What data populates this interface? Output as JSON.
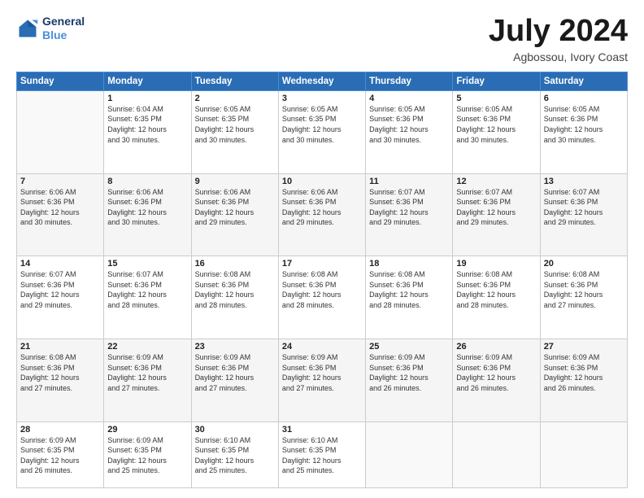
{
  "header": {
    "logo_line1": "General",
    "logo_line2": "Blue",
    "month_year": "July 2024",
    "location": "Agbossou, Ivory Coast"
  },
  "weekdays": [
    "Sunday",
    "Monday",
    "Tuesday",
    "Wednesday",
    "Thursday",
    "Friday",
    "Saturday"
  ],
  "weeks": [
    [
      {
        "day": "",
        "detail": ""
      },
      {
        "day": "1",
        "detail": "Sunrise: 6:04 AM\nSunset: 6:35 PM\nDaylight: 12 hours\nand 30 minutes."
      },
      {
        "day": "2",
        "detail": "Sunrise: 6:05 AM\nSunset: 6:35 PM\nDaylight: 12 hours\nand 30 minutes."
      },
      {
        "day": "3",
        "detail": "Sunrise: 6:05 AM\nSunset: 6:35 PM\nDaylight: 12 hours\nand 30 minutes."
      },
      {
        "day": "4",
        "detail": "Sunrise: 6:05 AM\nSunset: 6:36 PM\nDaylight: 12 hours\nand 30 minutes."
      },
      {
        "day": "5",
        "detail": "Sunrise: 6:05 AM\nSunset: 6:36 PM\nDaylight: 12 hours\nand 30 minutes."
      },
      {
        "day": "6",
        "detail": "Sunrise: 6:05 AM\nSunset: 6:36 PM\nDaylight: 12 hours\nand 30 minutes."
      }
    ],
    [
      {
        "day": "7",
        "detail": "Sunrise: 6:06 AM\nSunset: 6:36 PM\nDaylight: 12 hours\nand 30 minutes."
      },
      {
        "day": "8",
        "detail": "Sunrise: 6:06 AM\nSunset: 6:36 PM\nDaylight: 12 hours\nand 30 minutes."
      },
      {
        "day": "9",
        "detail": "Sunrise: 6:06 AM\nSunset: 6:36 PM\nDaylight: 12 hours\nand 29 minutes."
      },
      {
        "day": "10",
        "detail": "Sunrise: 6:06 AM\nSunset: 6:36 PM\nDaylight: 12 hours\nand 29 minutes."
      },
      {
        "day": "11",
        "detail": "Sunrise: 6:07 AM\nSunset: 6:36 PM\nDaylight: 12 hours\nand 29 minutes."
      },
      {
        "day": "12",
        "detail": "Sunrise: 6:07 AM\nSunset: 6:36 PM\nDaylight: 12 hours\nand 29 minutes."
      },
      {
        "day": "13",
        "detail": "Sunrise: 6:07 AM\nSunset: 6:36 PM\nDaylight: 12 hours\nand 29 minutes."
      }
    ],
    [
      {
        "day": "14",
        "detail": "Sunrise: 6:07 AM\nSunset: 6:36 PM\nDaylight: 12 hours\nand 29 minutes."
      },
      {
        "day": "15",
        "detail": "Sunrise: 6:07 AM\nSunset: 6:36 PM\nDaylight: 12 hours\nand 28 minutes."
      },
      {
        "day": "16",
        "detail": "Sunrise: 6:08 AM\nSunset: 6:36 PM\nDaylight: 12 hours\nand 28 minutes."
      },
      {
        "day": "17",
        "detail": "Sunrise: 6:08 AM\nSunset: 6:36 PM\nDaylight: 12 hours\nand 28 minutes."
      },
      {
        "day": "18",
        "detail": "Sunrise: 6:08 AM\nSunset: 6:36 PM\nDaylight: 12 hours\nand 28 minutes."
      },
      {
        "day": "19",
        "detail": "Sunrise: 6:08 AM\nSunset: 6:36 PM\nDaylight: 12 hours\nand 28 minutes."
      },
      {
        "day": "20",
        "detail": "Sunrise: 6:08 AM\nSunset: 6:36 PM\nDaylight: 12 hours\nand 27 minutes."
      }
    ],
    [
      {
        "day": "21",
        "detail": "Sunrise: 6:08 AM\nSunset: 6:36 PM\nDaylight: 12 hours\nand 27 minutes."
      },
      {
        "day": "22",
        "detail": "Sunrise: 6:09 AM\nSunset: 6:36 PM\nDaylight: 12 hours\nand 27 minutes."
      },
      {
        "day": "23",
        "detail": "Sunrise: 6:09 AM\nSunset: 6:36 PM\nDaylight: 12 hours\nand 27 minutes."
      },
      {
        "day": "24",
        "detail": "Sunrise: 6:09 AM\nSunset: 6:36 PM\nDaylight: 12 hours\nand 27 minutes."
      },
      {
        "day": "25",
        "detail": "Sunrise: 6:09 AM\nSunset: 6:36 PM\nDaylight: 12 hours\nand 26 minutes."
      },
      {
        "day": "26",
        "detail": "Sunrise: 6:09 AM\nSunset: 6:36 PM\nDaylight: 12 hours\nand 26 minutes."
      },
      {
        "day": "27",
        "detail": "Sunrise: 6:09 AM\nSunset: 6:36 PM\nDaylight: 12 hours\nand 26 minutes."
      }
    ],
    [
      {
        "day": "28",
        "detail": "Sunrise: 6:09 AM\nSunset: 6:35 PM\nDaylight: 12 hours\nand 26 minutes."
      },
      {
        "day": "29",
        "detail": "Sunrise: 6:09 AM\nSunset: 6:35 PM\nDaylight: 12 hours\nand 25 minutes."
      },
      {
        "day": "30",
        "detail": "Sunrise: 6:10 AM\nSunset: 6:35 PM\nDaylight: 12 hours\nand 25 minutes."
      },
      {
        "day": "31",
        "detail": "Sunrise: 6:10 AM\nSunset: 6:35 PM\nDaylight: 12 hours\nand 25 minutes."
      },
      {
        "day": "",
        "detail": ""
      },
      {
        "day": "",
        "detail": ""
      },
      {
        "day": "",
        "detail": ""
      }
    ]
  ]
}
